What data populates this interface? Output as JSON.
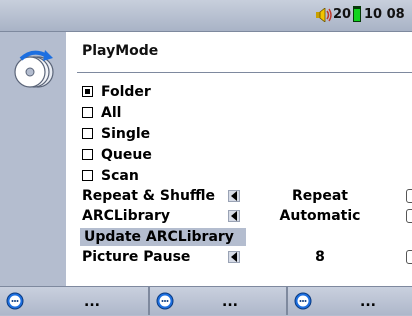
{
  "status": {
    "volume": "20",
    "clock": "10 08"
  },
  "menu": {
    "title": "PlayMode",
    "options": [
      {
        "label": "Folder",
        "checked": true
      },
      {
        "label": "All",
        "checked": false
      },
      {
        "label": "Single",
        "checked": false
      },
      {
        "label": "Queue",
        "checked": false
      },
      {
        "label": "Scan",
        "checked": false
      }
    ],
    "settings": {
      "repeat_shuffle": {
        "label": "Repeat & Shuffle",
        "value": "Repeat"
      },
      "arclibrary": {
        "label": "ARCLibrary",
        "value": "Automatic"
      },
      "picture_pause": {
        "label": "Picture Pause",
        "value": "8"
      }
    },
    "update_button": "Update ARCLibrary"
  },
  "softkeys": [
    "...",
    "...",
    "..."
  ],
  "colors": {
    "panel": "#b4bdcf",
    "battery": "#12d21f",
    "icon_blue": "#1d6fe0"
  }
}
